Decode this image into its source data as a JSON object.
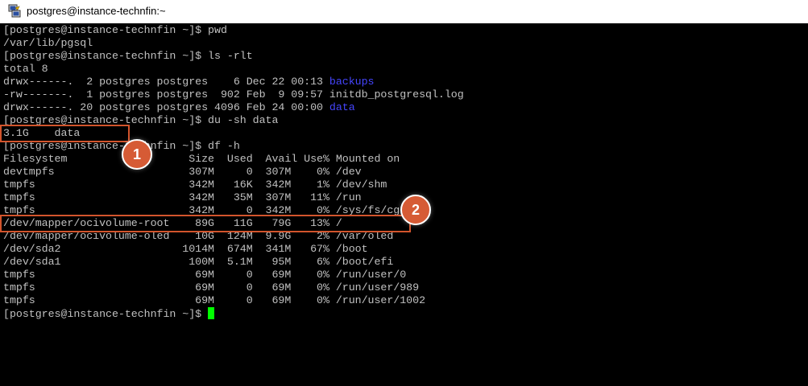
{
  "window": {
    "title": "postgres@instance-technfin:~",
    "icon": "putty-icon"
  },
  "terminal": {
    "lines": [
      {
        "text": "[postgres@instance-technfin ~]$ pwd"
      },
      {
        "text": "/var/lib/pgsql"
      },
      {
        "text": "[postgres@instance-technfin ~]$ ls -rlt"
      },
      {
        "text": "total 8"
      },
      {
        "text": "drwx------.  2 postgres postgres    6 Dec 22 00:13 ",
        "highlight": "backups"
      },
      {
        "text": "-rw-------.  1 postgres postgres  902 Feb  9 09:57 initdb_postgresql.log"
      },
      {
        "text": "drwx------. 20 postgres postgres 4096 Feb 24 00:00 ",
        "highlight": "data"
      },
      {
        "text": "[postgres@instance-technfin ~]$ du -sh data"
      },
      {
        "text": "3.1G    data"
      },
      {
        "text": "[postgres@instance-technfin ~]$ df -h"
      },
      {
        "text": "Filesystem                   Size  Used  Avail Use% Mounted on"
      },
      {
        "text": "devtmpfs                     307M     0  307M    0% /dev"
      },
      {
        "text": "tmpfs                        342M   16K  342M    1% /dev/shm"
      },
      {
        "text": "tmpfs                        342M   35M  307M   11% /run"
      },
      {
        "text": "tmpfs                        342M     0  342M    0% /sys/fs/cgroup"
      },
      {
        "text": "/dev/mapper/ocivolume-root    89G   11G   79G   13% /"
      },
      {
        "text": "/dev/mapper/ocivolume-oled    10G  124M  9.9G    2% /var/oled"
      },
      {
        "text": "/dev/sda2                   1014M  674M  341M   67% /boot"
      },
      {
        "text": "/dev/sda1                    100M  5.1M   95M    6% /boot/efi"
      },
      {
        "text": "tmpfs                         69M     0   69M    0% /run/user/0"
      },
      {
        "text": "tmpfs                         69M     0   69M    0% /run/user/989"
      },
      {
        "text": "tmpfs                         69M     0   69M    0% /run/user/1002"
      },
      {
        "text": "[postgres@instance-technfin ~]$ ",
        "cursor": true
      }
    ],
    "colors": {
      "background": "#000000",
      "foreground": "#c0c0c0",
      "directory": "#4545ff",
      "cursor": "#00ff00"
    }
  },
  "annotations": {
    "color": "#d2542c",
    "badges": [
      "1",
      "2"
    ]
  }
}
